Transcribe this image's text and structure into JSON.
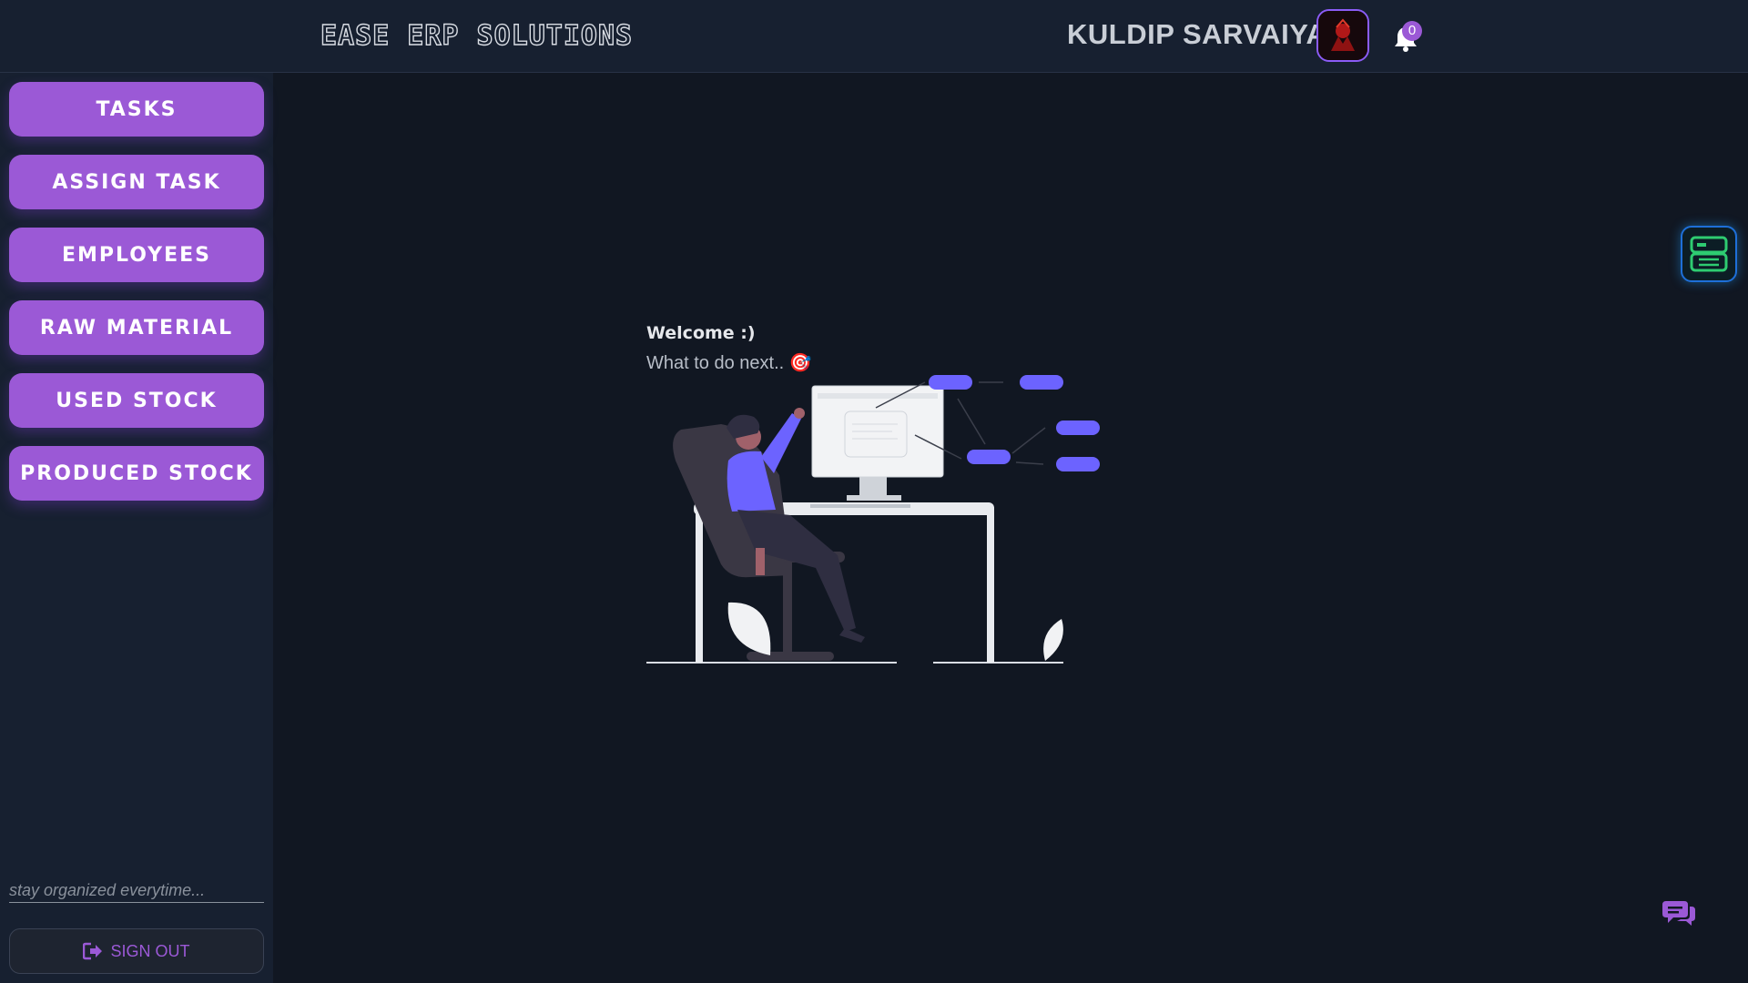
{
  "header": {
    "brand": "EASE ERP SOLUTIONS",
    "user_name": "KULDIP SARVAIYA",
    "notification_count": "0"
  },
  "sidebar": {
    "items": [
      {
        "label": "TASKS"
      },
      {
        "label": "ASSIGN TASK"
      },
      {
        "label": "EMPLOYEES"
      },
      {
        "label": "RAW MATERIAL"
      },
      {
        "label": "USED STOCK"
      },
      {
        "label": "PRODUCED STOCK"
      }
    ],
    "tagline": "stay organized everytime...",
    "signout_label": "SIGN OUT"
  },
  "main": {
    "welcome_title": "Welcome :)",
    "welcome_subtitle": "What to do next.. 🎯"
  },
  "colors": {
    "accent": "#9b59d6",
    "background": "#111722",
    "panel": "#172030",
    "illustration_accent": "#6c63ff"
  },
  "icons": {
    "notification": "bell-icon",
    "signout": "sign-out-icon",
    "widget": "server-panel-icon",
    "chat": "chat-bubbles-icon"
  }
}
